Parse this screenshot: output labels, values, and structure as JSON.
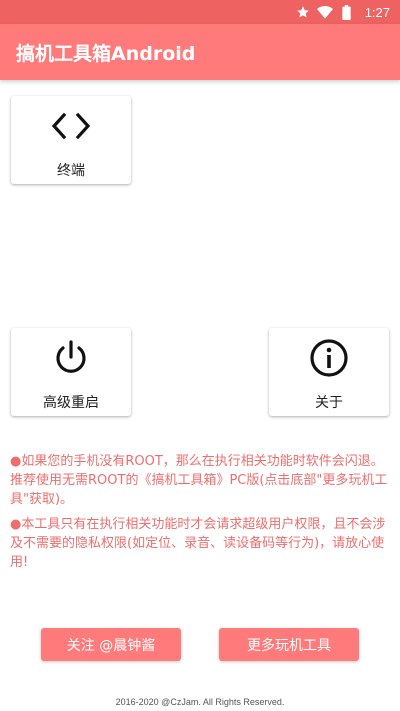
{
  "status_bar": {
    "time": "1:27",
    "icons": [
      "star-icon",
      "wifi-icon",
      "battery-icon"
    ]
  },
  "app_bar": {
    "title": "搞机工具箱Android",
    "color": "#ff7b7b"
  },
  "cards": {
    "terminal": {
      "label": "终端",
      "icon": "code-icon"
    },
    "reboot": {
      "label": "高级重启",
      "icon": "power-icon"
    },
    "about": {
      "label": "关于",
      "icon": "info-icon"
    }
  },
  "notices": [
    "●如果您的手机没有ROOT，那么在执行相关功能时软件会闪退。推荐使用无需ROOT的《搞机工具箱》PC版(点击底部\"更多玩机工具\"获取)。",
    "●本工具只有在执行相关功能时才会请求超级用户权限，且不会涉及不需要的隐私权限(如定位、录音、读设备码等行为)，请放心使用!"
  ],
  "buttons": {
    "follow": "关注 @晨钟酱",
    "more_tools": "更多玩机工具"
  },
  "footer": "2016-2020 @CzJam. All Rights Reserved.",
  "colors": {
    "status_bar": "#ee6262",
    "accent": "#ff7b7b",
    "notice_text": "#ee6e6e"
  }
}
